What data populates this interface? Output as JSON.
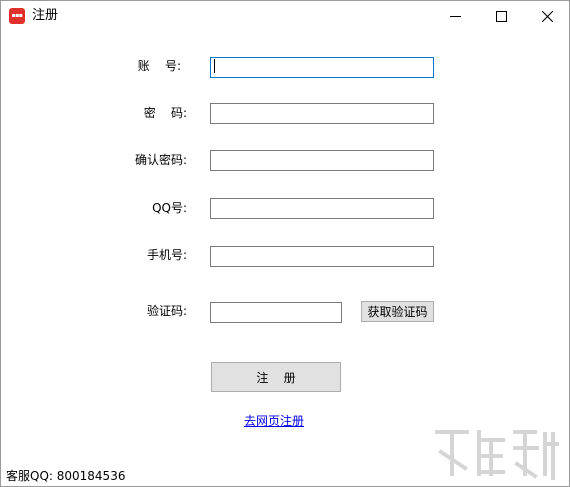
{
  "window": {
    "title": "注册",
    "icon": "app-logo-icon",
    "controls": {
      "minimize": "minimize-icon",
      "maximize": "maximize-icon",
      "close": "close-icon"
    }
  },
  "form": {
    "account_label": "账    号:",
    "password_label": "密    码:",
    "confirm_password_label": "确认密码:",
    "qq_label": "QQ号:",
    "phone_label": "手机号:",
    "code_label": "验证码:",
    "account_value": "",
    "password_value": "",
    "confirm_password_value": "",
    "qq_value": "",
    "phone_value": "",
    "code_value": "",
    "get_code_button": "获取验证码",
    "register_button": "注    册",
    "web_register_link": "去网页注册"
  },
  "footer": {
    "support_text": "客服QQ:  800184536"
  },
  "watermark": {
    "icon": "download-site-watermark-icon"
  },
  "colors": {
    "focus_border": "#0078d7",
    "link": "#0000ee",
    "icon_red": "#e0302b"
  }
}
